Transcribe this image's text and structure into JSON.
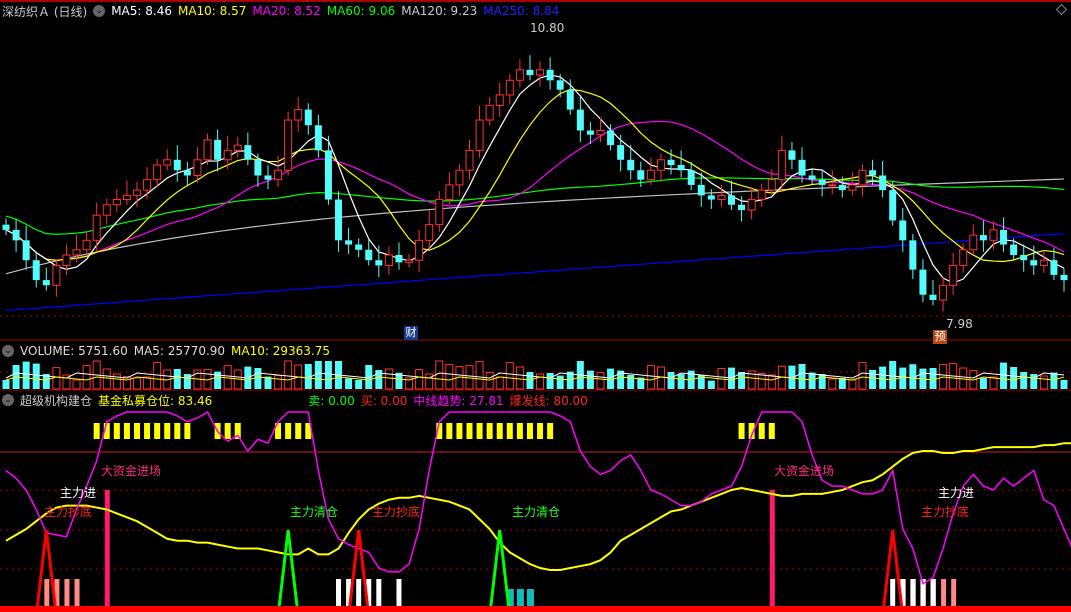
{
  "header": {
    "title": "深纺织Ａ (日线)",
    "ma5": "MA5: 8.46",
    "ma10": "MA10: 8.57",
    "ma20": "MA20: 8.52",
    "ma60": "MA60: 9.06",
    "ma120": "MA120: 9.23",
    "ma250": "MA250: 8.84"
  },
  "price_labels": {
    "high": "10.80",
    "low": "7.98"
  },
  "badges": {
    "cai": "财",
    "yu": "预"
  },
  "volume_header": {
    "volume": "VOLUME: 5751.60",
    "ma5": "MA5: 25770.90",
    "ma10": "MA10: 29363.75"
  },
  "indicator_header": {
    "name": "超级机构建仓",
    "fund": "基金私募仓位: 83.46",
    "sell": "卖: 0.00",
    "buy": "买: 0.00",
    "trend": "中线趋势: 27.81",
    "burst": "爆发线: 80.00"
  },
  "signal_labels": {
    "big_money": "大资金进场",
    "main_in": "主力进",
    "main_bottom": "主力抄底",
    "main_clear": "主力清仓"
  },
  "colors": {
    "up": "#ff3232",
    "down": "#54fcfc",
    "ma5": "#ffffff",
    "ma10": "#ffff00",
    "ma20": "#ff00ff",
    "ma60": "#00ff00",
    "ma120": "#c0c0c0",
    "ma250": "#0000ff"
  },
  "chart_data": {
    "type": "candlestick",
    "price_range": [
      7.98,
      10.8
    ],
    "closes": [
      8.87,
      8.77,
      8.58,
      8.39,
      8.34,
      8.53,
      8.63,
      8.68,
      8.77,
      9.01,
      9.11,
      9.16,
      9.2,
      9.25,
      9.35,
      9.49,
      9.54,
      9.44,
      9.39,
      9.54,
      9.73,
      9.54,
      9.63,
      9.68,
      9.54,
      9.39,
      9.35,
      9.44,
      9.92,
      10.02,
      9.87,
      9.63,
      9.16,
      8.77,
      8.73,
      8.68,
      8.58,
      8.53,
      8.63,
      8.56,
      8.58,
      8.77,
      8.92,
      9.16,
      9.3,
      9.44,
      9.63,
      9.92,
      10.06,
      10.16,
      10.3,
      10.4,
      10.35,
      10.4,
      10.3,
      10.21,
      10.02,
      9.82,
      9.78,
      9.82,
      9.68,
      9.54,
      9.44,
      9.35,
      9.44,
      9.54,
      9.49,
      9.44,
      9.3,
      9.2,
      9.16,
      9.2,
      9.11,
      9.06,
      9.16,
      9.25,
      9.35,
      9.63,
      9.54,
      9.39,
      9.35,
      9.3,
      9.3,
      9.25,
      9.3,
      9.44,
      9.39,
      9.25,
      8.96,
      8.77,
      8.49,
      8.25,
      8.2,
      8.34,
      8.53,
      8.68,
      8.82,
      8.77,
      8.87,
      8.73,
      8.63,
      8.58,
      8.53,
      8.58,
      8.44,
      8.39
    ],
    "indicator": {
      "range": [
        0,
        100
      ],
      "trend_magenta": [
        70,
        66,
        60,
        50,
        38,
        37,
        36,
        50,
        62,
        75,
        95,
        98,
        100,
        100,
        100,
        100,
        100,
        98,
        95,
        97,
        100,
        90,
        85,
        88,
        80,
        86,
        84,
        95,
        100,
        100,
        100,
        70,
        45,
        35,
        32,
        30,
        28,
        20,
        18,
        18,
        22,
        40,
        70,
        95,
        100,
        100,
        100,
        100,
        100,
        100,
        100,
        100,
        100,
        100,
        100,
        98,
        95,
        80,
        72,
        68,
        70,
        75,
        78,
        70,
        60,
        58,
        55,
        52,
        52,
        54,
        58,
        60,
        62,
        72,
        88,
        100,
        100,
        100,
        100,
        95,
        78,
        65,
        62,
        62,
        60,
        58,
        58,
        60,
        70,
        40,
        30,
        12,
        15,
        30,
        48,
        62,
        68,
        62,
        60,
        66,
        62,
        66,
        70,
        55,
        52,
        40,
        28
      ],
      "fund_yellow": [
        34,
        37,
        40,
        44,
        48,
        51,
        52,
        52,
        52,
        51,
        50,
        48,
        46,
        44,
        41,
        38,
        35,
        34,
        34,
        33,
        33,
        32,
        31,
        30,
        30,
        30,
        29,
        28,
        27,
        27,
        30,
        27,
        27,
        30,
        38,
        45,
        50,
        53,
        55,
        56,
        56,
        57,
        56,
        55,
        54,
        52,
        50,
        45,
        40,
        33,
        28,
        25,
        22,
        20,
        19,
        19,
        20,
        21,
        22,
        24,
        28,
        34,
        37,
        40,
        43,
        46,
        49,
        50,
        52,
        54,
        56,
        58,
        60,
        61,
        60,
        59,
        58,
        57,
        57,
        58,
        58,
        58,
        59,
        60,
        62,
        64,
        65,
        68,
        72,
        76,
        79,
        80,
        80,
        79,
        79,
        80,
        80,
        81,
        82,
        82,
        82,
        82,
        82,
        83,
        83,
        84,
        84
      ],
      "yellow_blocks": [
        9,
        10,
        11,
        12,
        13,
        14,
        15,
        16,
        17,
        18,
        21,
        22,
        23,
        27,
        28,
        29,
        30,
        43,
        44,
        45,
        46,
        47,
        48,
        49,
        50,
        51,
        52,
        53,
        54,
        73,
        74,
        75,
        76
      ],
      "red_peaks": [
        4,
        35,
        88
      ],
      "green_peaks": [
        28,
        49
      ],
      "big_money_bars": [
        10,
        76
      ],
      "salmon_bars": [
        4,
        5,
        6,
        7,
        89,
        90,
        91,
        92,
        93,
        94
      ],
      "white_bars": [
        33,
        34,
        35,
        36,
        37,
        39,
        88,
        89,
        90,
        91,
        92
      ],
      "teal_bars": [
        50,
        51,
        52
      ]
    }
  }
}
